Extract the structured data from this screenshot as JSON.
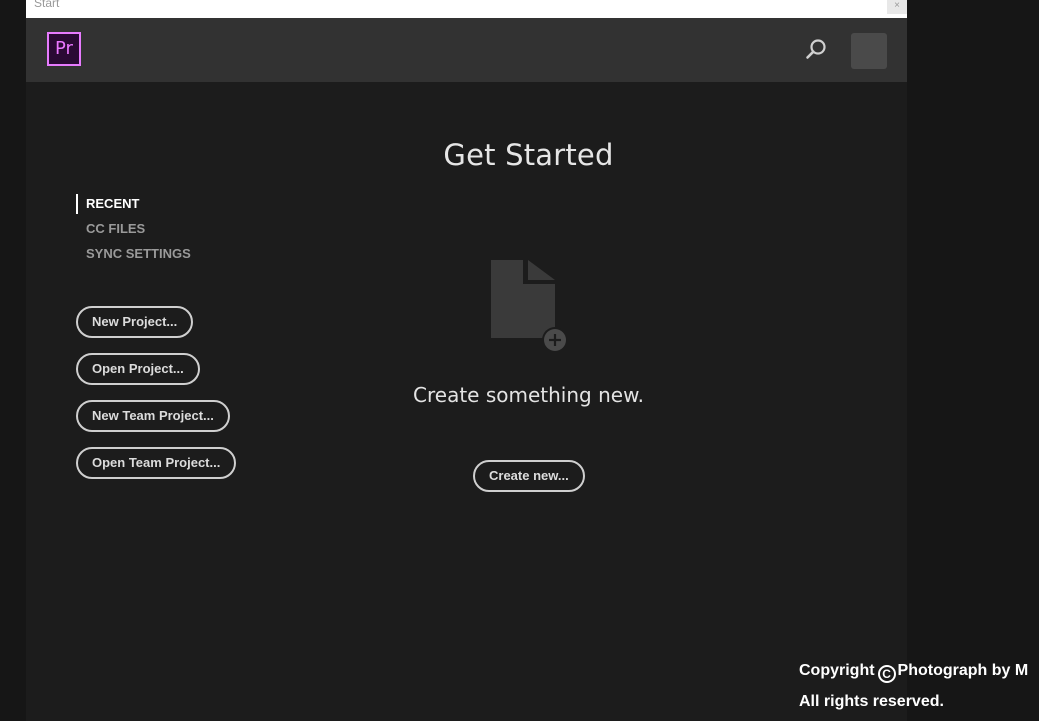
{
  "window": {
    "title": "Start",
    "close_glyph": "×"
  },
  "app": {
    "logo_text": "Pr",
    "search_icon": "search-icon",
    "avatar": "user-avatar",
    "accent_color": "#e77bfe"
  },
  "main": {
    "heading": "Get Started",
    "create_text": "Create something new.",
    "create_button": "Create new...",
    "file_icon": "new-file-icon"
  },
  "sidebar": {
    "nav_items": [
      {
        "label": "RECENT",
        "active": true
      },
      {
        "label": "CC FILES",
        "active": false
      },
      {
        "label": "SYNC SETTINGS",
        "active": false
      }
    ],
    "buttons": [
      {
        "label": "New Project..."
      },
      {
        "label": "Open Project..."
      },
      {
        "label": "New Team Project..."
      },
      {
        "label": "Open Team Project..."
      }
    ]
  },
  "watermark": {
    "line1_prefix": "Copyright",
    "copyright_symbol": "C",
    "line1_suffix": "Photograph by M",
    "line2": "All rights reserved."
  }
}
